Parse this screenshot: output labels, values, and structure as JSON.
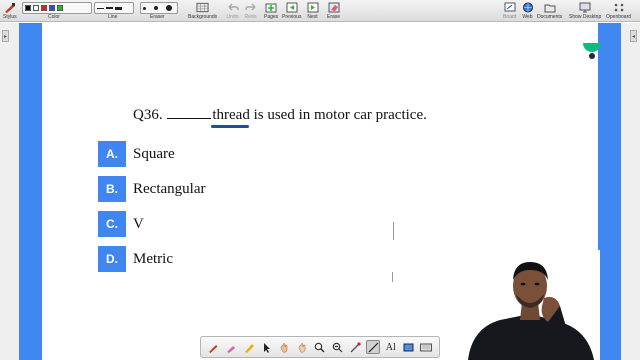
{
  "toolbar": {
    "stylus": "Stylus",
    "color": "Color",
    "line": "Line",
    "eraser": "Eraser",
    "backgrounds": "Backgrounds",
    "undo": "Undo",
    "redo": "Redo",
    "pages": "Pages",
    "previous": "Previous",
    "next": "Next",
    "erase": "Erase",
    "board": "Board",
    "web": "Web",
    "documents": "Documents",
    "show_desktop": "Show Desktop",
    "openboard": "Openboard",
    "colors": [
      "#111111",
      "#ffffff",
      "#e02020",
      "#2a52d8",
      "#2ab82a"
    ]
  },
  "question": {
    "number": "Q36.",
    "highlight": "thread",
    "rest": "is used in motor car practice."
  },
  "options": [
    {
      "letter": "A.",
      "text": "Square"
    },
    {
      "letter": "B.",
      "text": "Rectangular"
    },
    {
      "letter": "C.",
      "text": "V"
    },
    {
      "letter": "D.",
      "text": "Metric"
    }
  ],
  "colors": {
    "accent": "#3f86f0",
    "underline": "#1f4e9e",
    "logo_green": "#08bd80"
  },
  "palette_tools": [
    "pen-icon",
    "marker-icon",
    "highlighter-icon",
    "pointer-icon",
    "hand-icon",
    "pan-icon",
    "zoom-in-icon",
    "zoom-out-icon",
    "laser-icon",
    "line-tool-icon",
    "text-tool-icon",
    "capture-icon",
    "keyboard-icon"
  ]
}
